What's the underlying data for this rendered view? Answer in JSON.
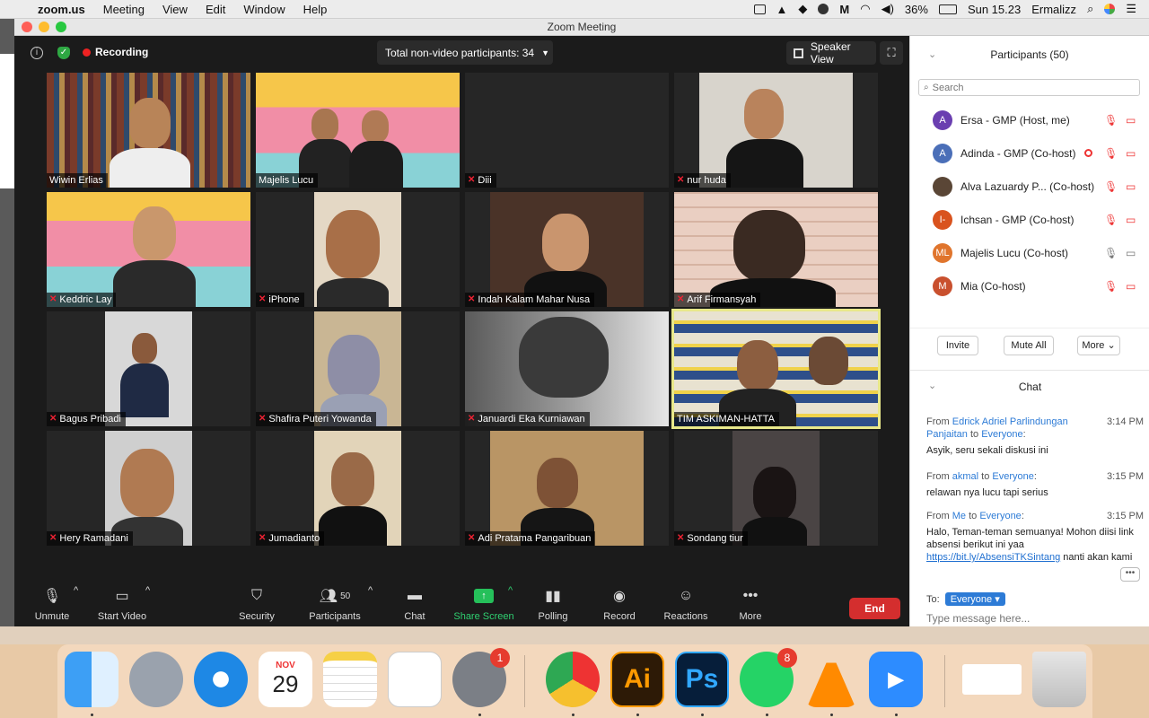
{
  "menubar": {
    "app_name": "zoom.us",
    "menus": [
      "Meeting",
      "View",
      "Edit",
      "Window",
      "Help"
    ],
    "battery": "36%",
    "clock": "Sun 15.23",
    "user": "Ermalizz"
  },
  "window": {
    "title": "Zoom Meeting"
  },
  "topbar": {
    "recording_label": "Recording",
    "nonvideo_label": "Total non-video participants: 34",
    "speaker_view_label": "Speaker View"
  },
  "tiles": [
    {
      "name": "Wiwin Erlias",
      "muted": false
    },
    {
      "name": "Majelis Lucu",
      "muted": false
    },
    {
      "name": "Diii",
      "muted": true
    },
    {
      "name": "nur huda",
      "muted": true
    },
    {
      "name": "Keddric Lay",
      "muted": true
    },
    {
      "name": "iPhone",
      "muted": true
    },
    {
      "name": "Indah Kalam Mahar Nusa",
      "muted": true
    },
    {
      "name": "Arif Firmansyah",
      "muted": true
    },
    {
      "name": "Bagus Pribadi",
      "muted": true
    },
    {
      "name": "Shafira Puteri Yowanda",
      "muted": true
    },
    {
      "name": "Januardi Eka Kurniawan",
      "muted": true
    },
    {
      "name": "TIM ASKIMAN-HATTA",
      "muted": false
    },
    {
      "name": "Hery Ramadani",
      "muted": true
    },
    {
      "name": "Jumadianto",
      "muted": true
    },
    {
      "name": "Adi Pratama Pangaribuan",
      "muted": true
    },
    {
      "name": "Sondang tiur",
      "muted": true
    }
  ],
  "toolbar": {
    "unmute": "Unmute",
    "start_video": "Start Video",
    "security": "Security",
    "participants": "Participants",
    "participants_count": "50",
    "chat": "Chat",
    "share_screen": "Share Screen",
    "polling": "Polling",
    "record": "Record",
    "reactions": "Reactions",
    "more": "More",
    "end": "End"
  },
  "participants_panel": {
    "title": "Participants (50)",
    "search_placeholder": "Search",
    "list": [
      {
        "initial": "A",
        "name": "Ersa - GMP (Host, me)",
        "color": "#6a3fb0"
      },
      {
        "initial": "A",
        "name": "Adinda - GMP  (Co-host)",
        "color": "#4b6fb8"
      },
      {
        "initial": "",
        "name": "Alva Lazuardy P...  (Co-host)",
        "color": "#5a4636"
      },
      {
        "initial": "I-",
        "name": "Ichsan - GMP (Co-host)",
        "color": "#d9531e"
      },
      {
        "initial": "ML",
        "name": "Majelis Lucu (Co-host)",
        "color": "#e0752d"
      },
      {
        "initial": "M",
        "name": "Mia  (Co-host)",
        "color": "#c9502e"
      }
    ],
    "invite": "Invite",
    "mute_all": "Mute All",
    "more": "More"
  },
  "chat_panel": {
    "title": "Chat",
    "messages": [
      {
        "from_label": "From",
        "sender": "Edrick Adriel Parlindungan Panjaitan",
        "to_label": "to",
        "recipient": "Everyone",
        "time": "3:14 PM",
        "text": "Asyik, seru sekali diskusi ini"
      },
      {
        "from_label": "From",
        "sender": "akmal",
        "to_label": "to",
        "recipient": "Everyone",
        "time": "3:15 PM",
        "text": "relawan nya lucu tapi serius"
      },
      {
        "from_label": "From",
        "sender": "Me",
        "to_label": "to",
        "recipient": "Everyone",
        "time": "3:15 PM",
        "text_before": "Halo, Teman-teman semuanya! Mohon diisi link absensi berikut ini yaa ",
        "link": "https://bit.ly/AbsensiTKSintang",
        "text_after": " nanti akan kami kirimkan e-sertifikat setelah mengisi link tersebut."
      }
    ],
    "to_label": "To:",
    "to_value": "Everyone",
    "input_placeholder": "Type message here..."
  },
  "dock": {
    "calendar_month": "NOV",
    "calendar_day": "29",
    "settings_badge": "1",
    "whatsapp_badge": "8",
    "illustrator_label": "Ai",
    "photoshop_label": "Ps"
  }
}
